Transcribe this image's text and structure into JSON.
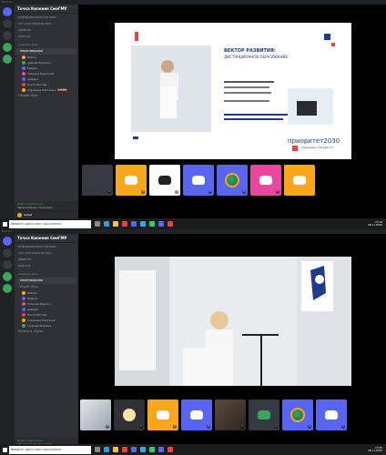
{
  "top": {
    "titlebar": "Discord",
    "server": "Точка Кипения СмеГМУ",
    "channels": [
      "информационн каналы",
      "чат для нерегистри...",
      "оффтоп",
      "анонсы"
    ],
    "voice_category": "комнаты для...",
    "voice_channels": [
      "переговорная",
      "Общий сбор"
    ],
    "users": [
      "Nature",
      "iglesias fremshu...",
      "Мишка",
      "Татьяна Фургатой",
      "димара",
      "Настя Батова",
      "Сорокина Настасья"
    ],
    "live_badge": "В ЭФИРЕ",
    "voice_status": "Видео подключено",
    "voice_sub": "переговорная / Точка Кип...",
    "username": "lacted",
    "user_tag": "#0790",
    "slide": {
      "heading1": "ВЕКТОР РАЗВИТИЯ:",
      "heading2": "ДИСТАНЦИОННОЕ ОБРАЗОВАНИЕ",
      "brand": "приоритет2030",
      "brand_sub": "лидерами становятся"
    }
  },
  "taskbar": {
    "search_placeholder": "Введите здесь текст для поиска",
    "lang": "РУС",
    "time_top": "15:14",
    "date_top": "28.11.2022",
    "time_bottom": "15:50",
    "date_bottom": "28.11.2022"
  },
  "bottom": {
    "titlebar": "Discord",
    "server": "Точка Кипения СмеГМУ",
    "channels": [
      "информационн каналы",
      "чат для нерегистри...",
      "оффтоп",
      "анонсы"
    ],
    "voice_category": "комнаты для...",
    "voice_channels": [
      "переговорная",
      "Общий сбор"
    ],
    "users": [
      "Nature",
      "Мишка",
      "Татьяна Фургат...",
      "димара",
      "Настя Батова",
      "Сорокина Настасья",
      "Гуцкова Милена"
    ],
    "extra_channel": "Комната сбора",
    "voice_status": "Видео подключено",
    "voice_sub": "переговорная / Точка Кип...",
    "username": "lacted",
    "user_tag": "#0790"
  },
  "colors": {
    "discord_blurple": "#5865f2",
    "discord_orange": "#faa61a",
    "discord_green": "#3ba55d",
    "discord_red": "#ed4245",
    "discord_pink": "#eb459e"
  }
}
